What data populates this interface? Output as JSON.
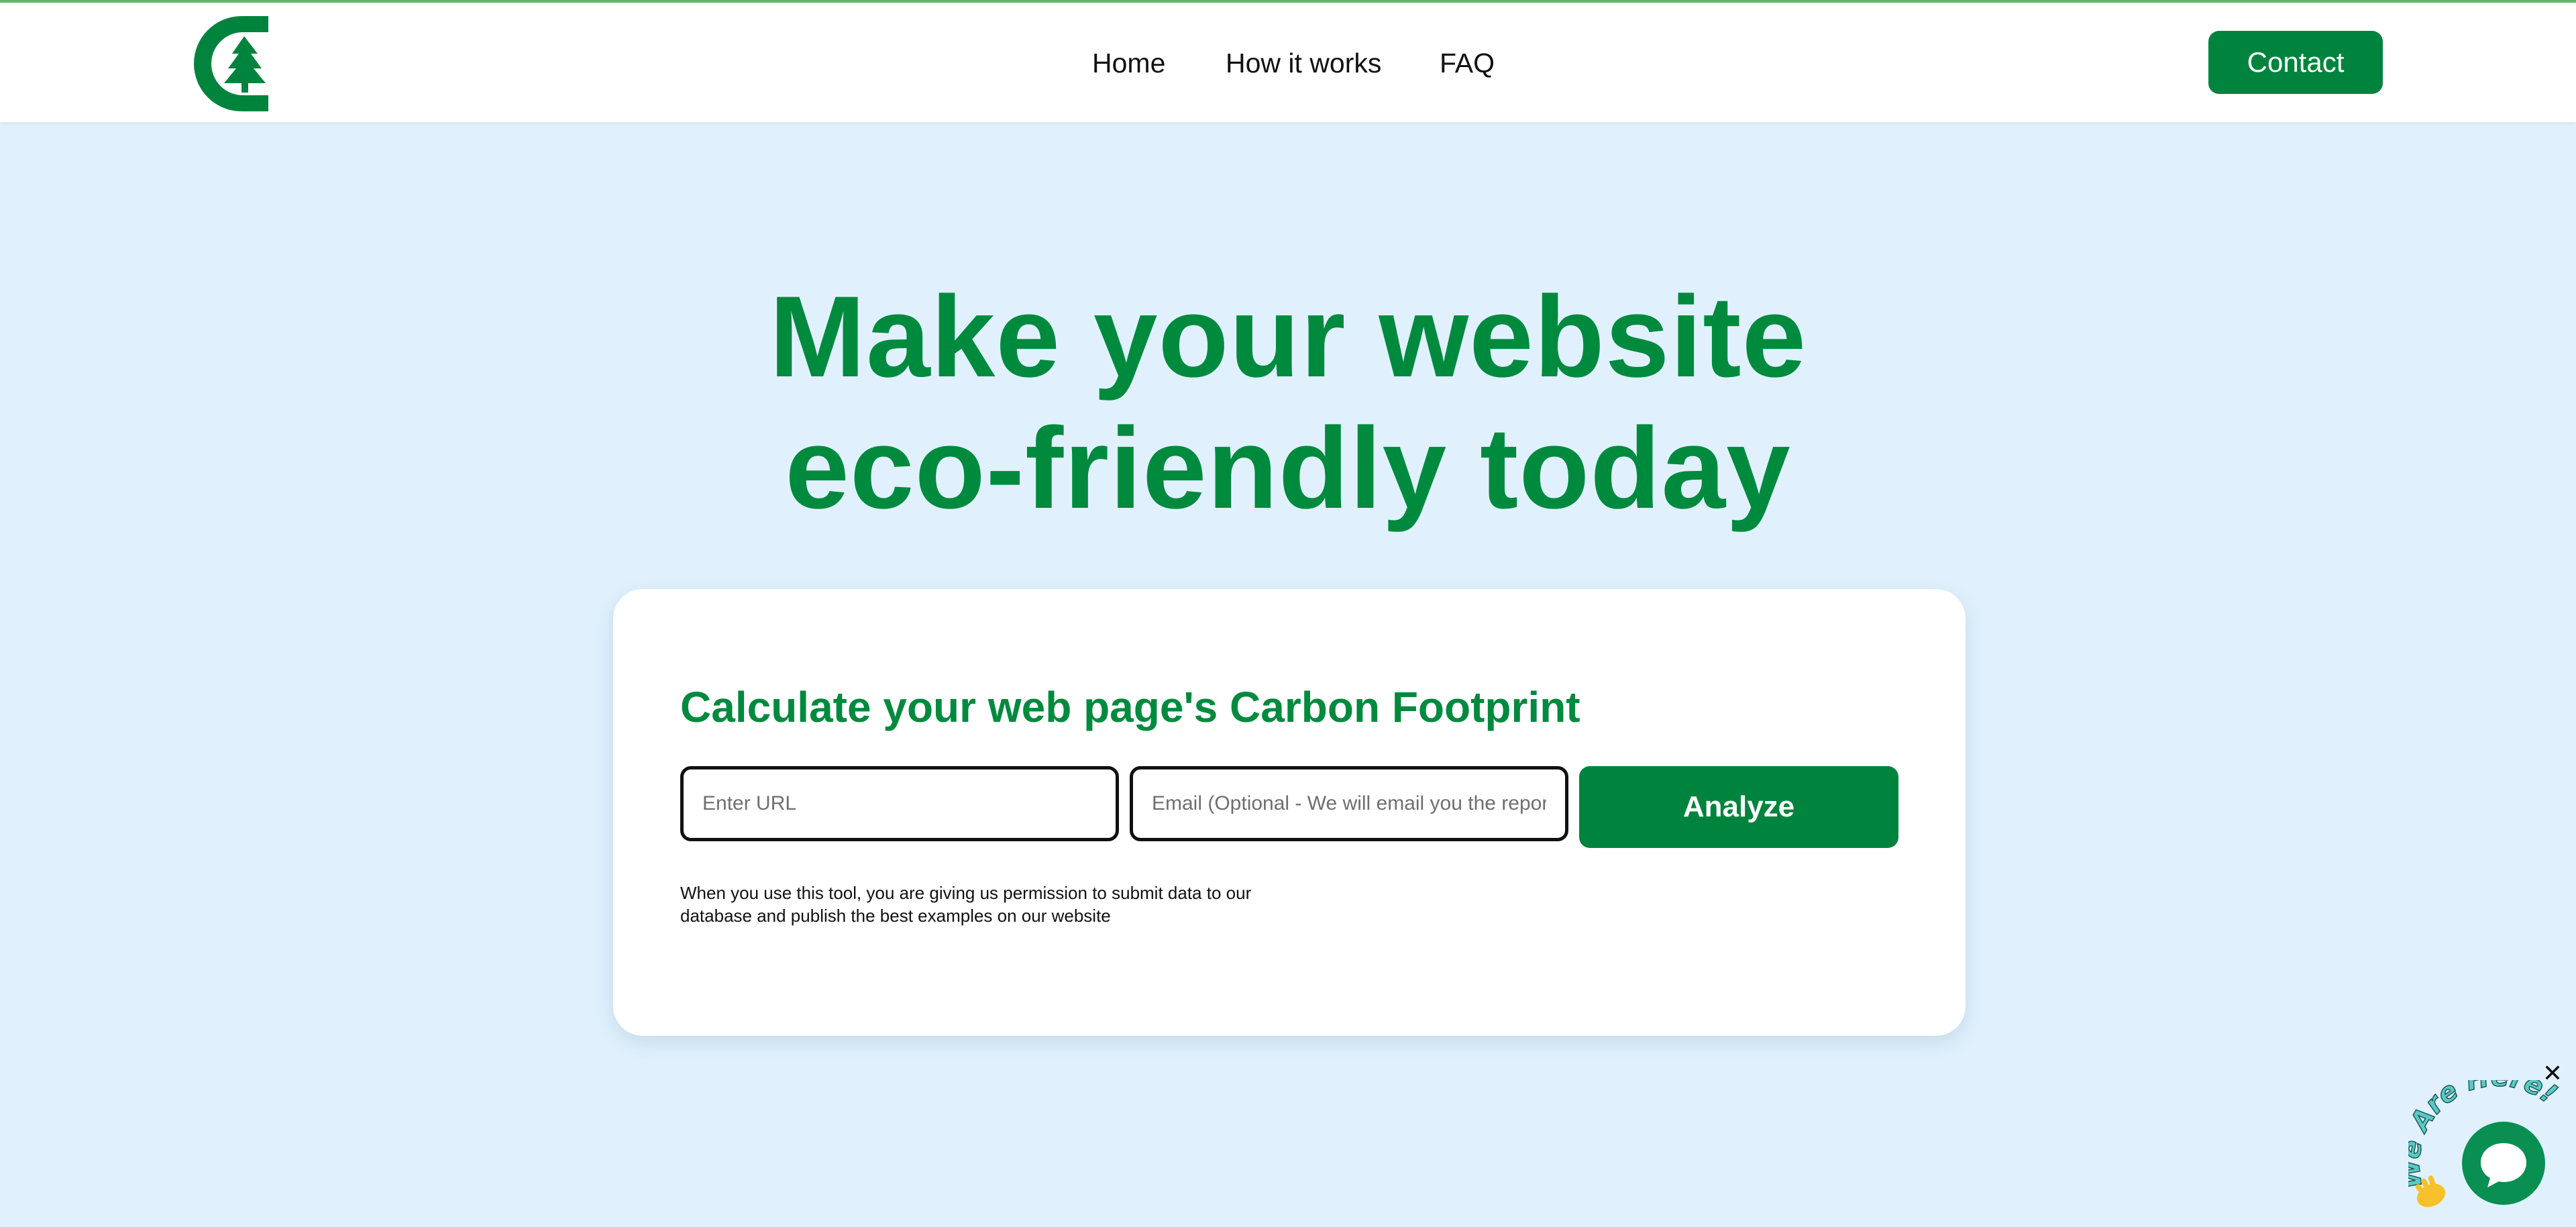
{
  "nav": {
    "home": "Home",
    "how_it_works": "How it works",
    "faq": "FAQ",
    "contact": "Contact"
  },
  "hero": {
    "line1": "Make your website",
    "line2": "eco-friendly today"
  },
  "calculator": {
    "title": "Calculate your web page's Carbon Footprint",
    "url_placeholder": "Enter URL",
    "email_placeholder": "Email (Optional - We will email you the report.)",
    "analyze_label": "Analyze",
    "disclaimer_line1": "When you use this tool, you are giving us permission to submit data to our",
    "disclaimer_line2": "database and publish the best examples on our website"
  },
  "chat": {
    "badge_text": "We Are Here!",
    "close_glyph": "✕"
  },
  "colors": {
    "brand_green": "#00843d",
    "hero_green": "#008a3e",
    "page_background": "#e0f1fd",
    "chat_green": "#0a8f52"
  },
  "icons": {
    "logo": "tree-c-logo-icon",
    "chat": "chat-bubble-icon",
    "close": "close-icon",
    "wave": "waving-hand-icon"
  }
}
